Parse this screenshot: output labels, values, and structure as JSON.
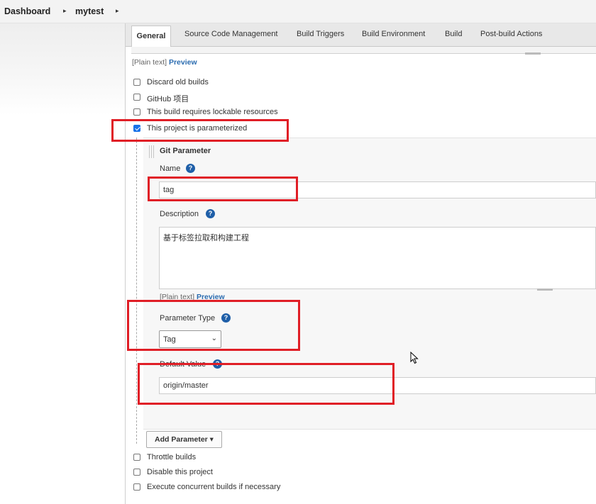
{
  "breadcrumb": {
    "items": [
      "Dashboard",
      "mytest"
    ]
  },
  "tabs": [
    "General",
    "Source Code Management",
    "Build Triggers",
    "Build Environment",
    "Build",
    "Post-build Actions"
  ],
  "markup": {
    "plain_text": "[Plain text]",
    "preview": "Preview"
  },
  "options_top": [
    {
      "label": "Discard old builds",
      "checked": false
    },
    {
      "label": "GitHub 项目",
      "checked": false
    },
    {
      "label": "This build requires lockable resources",
      "checked": false
    },
    {
      "label": "This project is parameterized",
      "checked": true
    }
  ],
  "parameter": {
    "title": "Git Parameter",
    "name_label": "Name",
    "name_value": "tag",
    "description_label": "Description",
    "description_value": "基于标签拉取和构建工程",
    "type_label": "Parameter Type",
    "type_value": "Tag",
    "default_label": "Default Value",
    "default_value": "origin/master",
    "help_glyph": "?"
  },
  "add_parameter": {
    "label": "Add Parameter",
    "caret": "▾"
  },
  "options_bottom": [
    {
      "label": "Throttle builds",
      "checked": false
    },
    {
      "label": "Disable this project",
      "checked": false
    },
    {
      "label": "Execute concurrent builds if necessary",
      "checked": false
    }
  ],
  "colors": {
    "annotation": "#e01e26",
    "link": "#2b6cb0",
    "help": "#1f5fa8",
    "checkbox": "#1a73e8"
  }
}
